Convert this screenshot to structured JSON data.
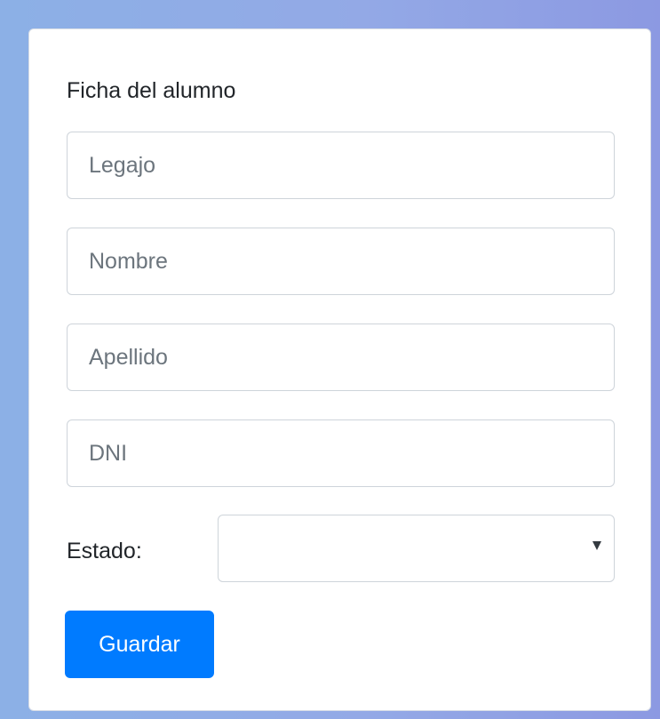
{
  "form": {
    "title": "Ficha del alumno",
    "fields": [
      {
        "placeholder": "Legajo",
        "value": ""
      },
      {
        "placeholder": "Nombre",
        "value": ""
      },
      {
        "placeholder": "Apellido",
        "value": ""
      },
      {
        "placeholder": "DNI",
        "value": ""
      }
    ],
    "estado": {
      "label": "Estado:",
      "selected": ""
    },
    "save_label": "Guardar"
  },
  "colors": {
    "accent": "#007bff",
    "card_background": "#ffffff",
    "page_background": "#8fa9e5"
  },
  "icons": {
    "select_arrow": "chevron-down-icon"
  }
}
